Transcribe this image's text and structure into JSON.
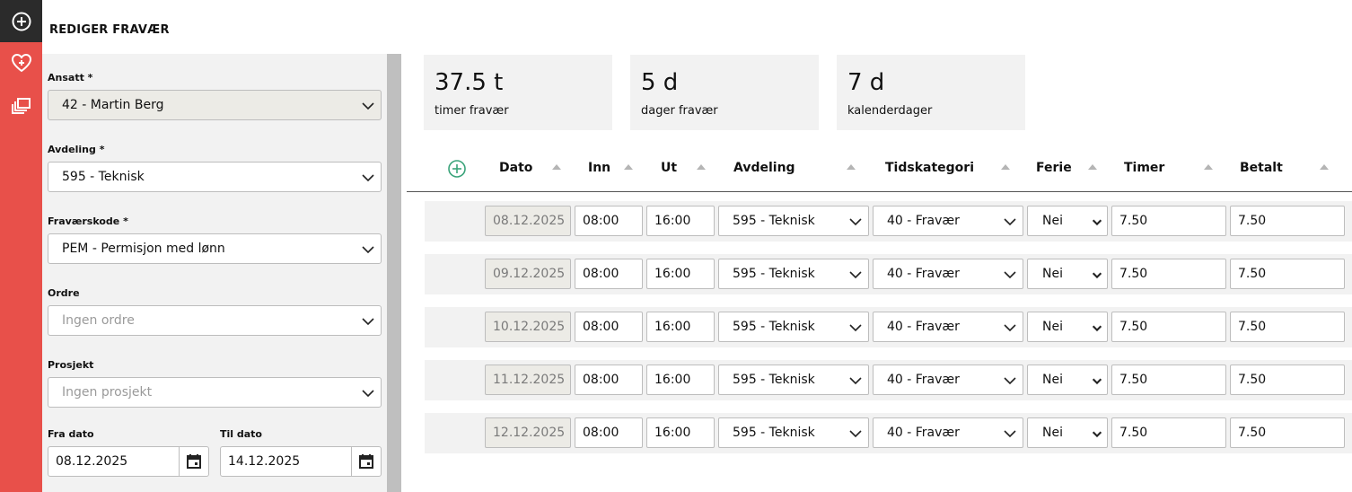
{
  "page": {
    "title": "REDIGER FRAVÆR"
  },
  "rail": {
    "icons": [
      "plus-circle-icon",
      "heart-plus-icon",
      "copy-icon"
    ]
  },
  "form": {
    "employee": {
      "label": "Ansatt *",
      "value": "42 - Martin Berg"
    },
    "department": {
      "label": "Avdeling *",
      "value": "595 - Teknisk"
    },
    "absence_code": {
      "label": "Fraværskode *",
      "value": "PEM - Permisjon med lønn"
    },
    "order": {
      "label": "Ordre",
      "placeholder": "Ingen ordre"
    },
    "project": {
      "label": "Prosjekt",
      "placeholder": "Ingen prosjekt"
    },
    "from_date": {
      "label": "Fra dato",
      "value": "08.12.2025"
    },
    "to_date": {
      "label": "Til dato",
      "value": "14.12.2025"
    }
  },
  "summary": [
    {
      "value": "37.5 t",
      "label": "timer fravær"
    },
    {
      "value": "5 d",
      "label": "dager fravær"
    },
    {
      "value": "7 d",
      "label": "kalenderdager"
    }
  ],
  "table": {
    "columns": [
      "Dato",
      "Inn",
      "Ut",
      "Avdeling",
      "Tidskategori",
      "Ferie",
      "Timer",
      "Betalt"
    ],
    "rows": [
      {
        "date": "08.12.2025",
        "in": "08:00",
        "out": "16:00",
        "department": "595 - Teknisk",
        "category": "40 - Fravær",
        "vacation": "Nei",
        "hours": "7.50",
        "paid": "7.50"
      },
      {
        "date": "09.12.2025",
        "in": "08:00",
        "out": "16:00",
        "department": "595 - Teknisk",
        "category": "40 - Fravær",
        "vacation": "Nei",
        "hours": "7.50",
        "paid": "7.50"
      },
      {
        "date": "10.12.2025",
        "in": "08:00",
        "out": "16:00",
        "department": "595 - Teknisk",
        "category": "40 - Fravær",
        "vacation": "Nei",
        "hours": "7.50",
        "paid": "7.50"
      },
      {
        "date": "11.12.2025",
        "in": "08:00",
        "out": "16:00",
        "department": "595 - Teknisk",
        "category": "40 - Fravær",
        "vacation": "Nei",
        "hours": "7.50",
        "paid": "7.50"
      },
      {
        "date": "12.12.2025",
        "in": "08:00",
        "out": "16:00",
        "department": "595 - Teknisk",
        "category": "40 - Fravær",
        "vacation": "Nei",
        "hours": "7.50",
        "paid": "7.50"
      }
    ]
  },
  "colors": {
    "rail": "#e8504a",
    "rail_top": "#2b2b2b",
    "accent_green": "#3aa37a",
    "panel": "#f2f2f2"
  }
}
